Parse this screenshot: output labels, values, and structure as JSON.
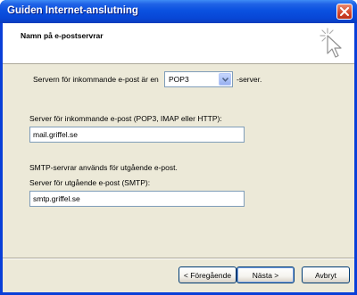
{
  "window": {
    "title": "Guiden Internet-anslutning"
  },
  "header": {
    "title": "Namn på e-postservrar"
  },
  "incoming_type": {
    "prefix": "Servern för inkommande e-post är en",
    "selected": "POP3",
    "suffix": "-server."
  },
  "incoming_server": {
    "label": "Server för inkommande e-post (POP3, IMAP eller HTTP):",
    "value": "mail.griffel.se"
  },
  "outgoing": {
    "info": "SMTP-servrar används för utgående e-post.",
    "label": "Server för utgående e-post (SMTP):",
    "value": "smtp.griffel.se"
  },
  "buttons": {
    "back": "< Föregående",
    "next": "Nästa >",
    "cancel": "Avbryt"
  },
  "colors": {
    "titlebar": "#0a51e0",
    "client": "#ece9d8",
    "field_border": "#7f9db9"
  }
}
